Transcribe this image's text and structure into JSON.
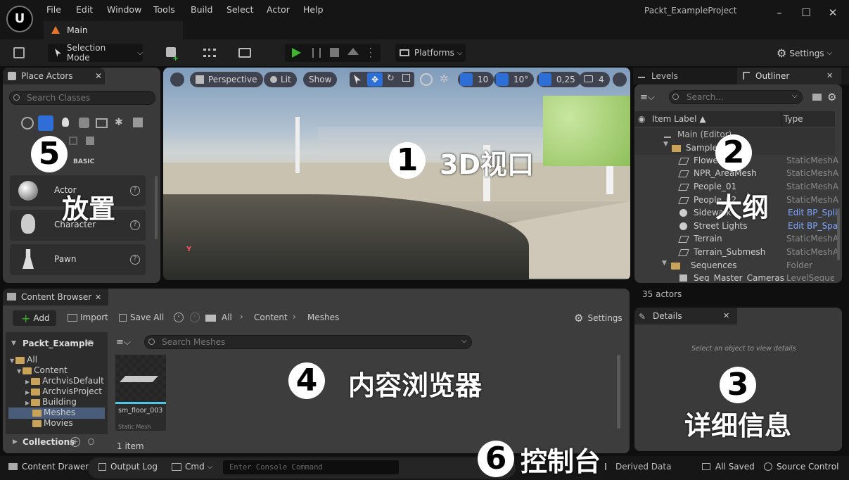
{
  "menu": {
    "items": [
      "File",
      "Edit",
      "Window",
      "Tools",
      "Build",
      "Select",
      "Actor",
      "Help"
    ],
    "project": "Packt_ExampleProject",
    "level_tab": "Main"
  },
  "toolbar": {
    "mode": "Selection Mode",
    "platforms": "Platforms",
    "settings": "Settings"
  },
  "place_actors": {
    "title": "Place Actors",
    "search_placeholder": "Search Classes",
    "category": "BASIC",
    "items": [
      {
        "label": "Actor"
      },
      {
        "label": "Character"
      },
      {
        "label": "Pawn"
      }
    ]
  },
  "viewport": {
    "perspective": "Perspective",
    "lit": "Lit",
    "show": "Show",
    "grid": "10",
    "angle": "10°",
    "scale": "0,25",
    "camera": "4",
    "axis_label": "Y"
  },
  "outliner": {
    "levels_tab": "Levels",
    "title": "Outliner",
    "search_placeholder": "Search...",
    "col_label": "Item Label",
    "col_type": "Type",
    "rows": [
      {
        "label": "Main (Editor)",
        "type": ""
      },
      {
        "label": "Sample",
        "type": ""
      },
      {
        "label": "Flowers",
        "type": "StaticMeshA"
      },
      {
        "label": "NPR_AreaMesh",
        "type": "StaticMeshA"
      },
      {
        "label": "People_01",
        "type": "StaticMeshA"
      },
      {
        "label": "People_02",
        "type": "StaticMeshA"
      },
      {
        "label": "Sidewalk",
        "type": "Edit BP_Spli"
      },
      {
        "label": "Street Lights",
        "type": "Edit BP_Spa"
      },
      {
        "label": "Terrain",
        "type": "StaticMeshA"
      },
      {
        "label": "Terrain_Submesh",
        "type": "StaticMeshA"
      },
      {
        "label": "Sequences",
        "type": "Folder"
      },
      {
        "label": "Seq_Master_Cameras",
        "type": "LevelSequer"
      }
    ],
    "count": "35 actors"
  },
  "details": {
    "title": "Details",
    "empty": "Select an object to view details"
  },
  "content_browser": {
    "title": "Content Browser",
    "add": "Add",
    "import": "Import",
    "save_all": "Save All",
    "settings": "Settings",
    "path": [
      "All",
      "Content",
      "Meshes"
    ],
    "project": "Packt_Example",
    "search_placeholder": "Search Meshes",
    "tree": [
      "All",
      "Content",
      "ArchvisDefault",
      "ArchvisProject",
      "Building",
      "Meshes",
      "Movies"
    ],
    "collections": "Collections",
    "asset_name": "sm_floor_003",
    "asset_type": "Static Mesh",
    "item_count": "1 item"
  },
  "statusbar": {
    "drawer": "Content Drawer",
    "output": "Output Log",
    "cmd": "Cmd",
    "console_placeholder": "Enter Console Command",
    "derived": "Derived Data",
    "saved": "All Saved",
    "source": "Source Control"
  },
  "annotations": {
    "n1": "1",
    "l1": "3D视口",
    "n2": "2",
    "l2": "大纲",
    "n3": "3",
    "l3": "详细信息",
    "n4": "4",
    "l4": "内容浏览器",
    "n5": "5",
    "l5": "放置",
    "n6": "6",
    "l6": "控制台"
  }
}
